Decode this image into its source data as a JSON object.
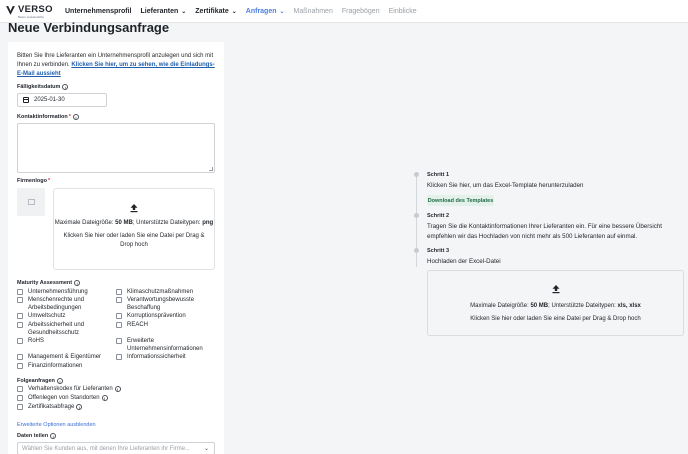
{
  "nav": {
    "logo_name": "VERSO",
    "logo_tagline": "Better sustainability",
    "items": [
      {
        "label": "Unternehmensprofil",
        "state": "normal",
        "chevron": false
      },
      {
        "label": "Lieferanten",
        "state": "normal",
        "chevron": true
      },
      {
        "label": "Zertifikate",
        "state": "normal",
        "chevron": true
      },
      {
        "label": "Anfragen",
        "state": "active",
        "chevron": true
      },
      {
        "label": "Maßnahmen",
        "state": "disabled",
        "chevron": false
      },
      {
        "label": "Fragebögen",
        "state": "disabled",
        "chevron": false
      },
      {
        "label": "Einblicke",
        "state": "disabled",
        "chevron": false
      }
    ],
    "chevron_glyph": "⌄"
  },
  "page_title": "Neue Verbindungsanfrage",
  "form": {
    "intro_text": "Bitten Sie Ihre Lieferanten ein Unternehmensprofil anzulegen und sich mit Ihnen zu verbinden.",
    "intro_link": "Klicken Sie hier, um zu sehen, wie die Einladungs-E-Mail aussieht",
    "due_label": "Fälligkeitsdatum",
    "due_value": "2025-01-30",
    "contact_label": "Kontaktinformation",
    "required_mark": "*",
    "logo_label": "Firmenlogo",
    "logo_drop": {
      "max_prefix": "Maximale Dateigröße:",
      "max_value": "50 MB",
      "types_prefix": "; Unterstützte Dateitypen:",
      "types_value": "png",
      "help": "Klicken Sie hier oder laden Sie eine Datei per Drag & Drop hoch"
    },
    "maturity_label": "Maturity Assessment",
    "maturity_left": [
      "Unternehmensführung",
      "Menschenrechte und Arbeitsbedingungen",
      "Umweltschutz",
      "Arbeitssicherheit und Gesundheitsschutz",
      "RoHS",
      "Management & Eigentümer",
      "Finanzinformationen"
    ],
    "maturity_right": [
      "Klimaschutzmaßnahmen",
      "Verantwortungsbewusste Beschaffung",
      "Korruptionsprävention",
      "REACH",
      "Erweiterte Unternehmensinformationen",
      "Informationssicherheit"
    ],
    "followup_label": "Folgeanfragen",
    "followups": [
      "Verhaltenskodex für Lieferanten",
      "Offenlegen von Standorten",
      "Zertifikatsabfrage"
    ],
    "advanced_link": "Erweiterte Optionen ausblenden",
    "share_label": "Daten teilen",
    "share_placeholder": "Wählen Sie Kunden aus, mit denen Ihre Lieferanten ihr Firme..."
  },
  "steps": {
    "step1_title": "Schritt 1",
    "step1_text": "Klicken Sie hier, um das Excel-Template herunterzuladen",
    "template_button": "Download des Templates",
    "step2_title": "Schritt 2",
    "step2_text": "Tragen Sie die Kontaktinformationen Ihrer Lieferanten ein. Für eine bessere Übersicht empfehlen wir das Hochladen von nicht mehr als 500 Lieferanten auf einmal.",
    "step3_title": "Schritt 3",
    "step3_text": "Hochladen der Excel-Datei",
    "drop_max_prefix": "Maximale Dateigröße:",
    "drop_max_value": "50 MB",
    "drop_types_prefix": "; Unterstützte Dateitypen:",
    "drop_types_value": "xls, xlsx",
    "drop_help": "Klicken Sie hier oder laden Sie eine Datei per Drag & Drop hoch"
  },
  "colors": {
    "accent": "#4d7fe0",
    "link": "#1f5fae",
    "template_bg": "#e4f1ea",
    "template_text": "#1f6b45",
    "required": "#d13b3b"
  }
}
